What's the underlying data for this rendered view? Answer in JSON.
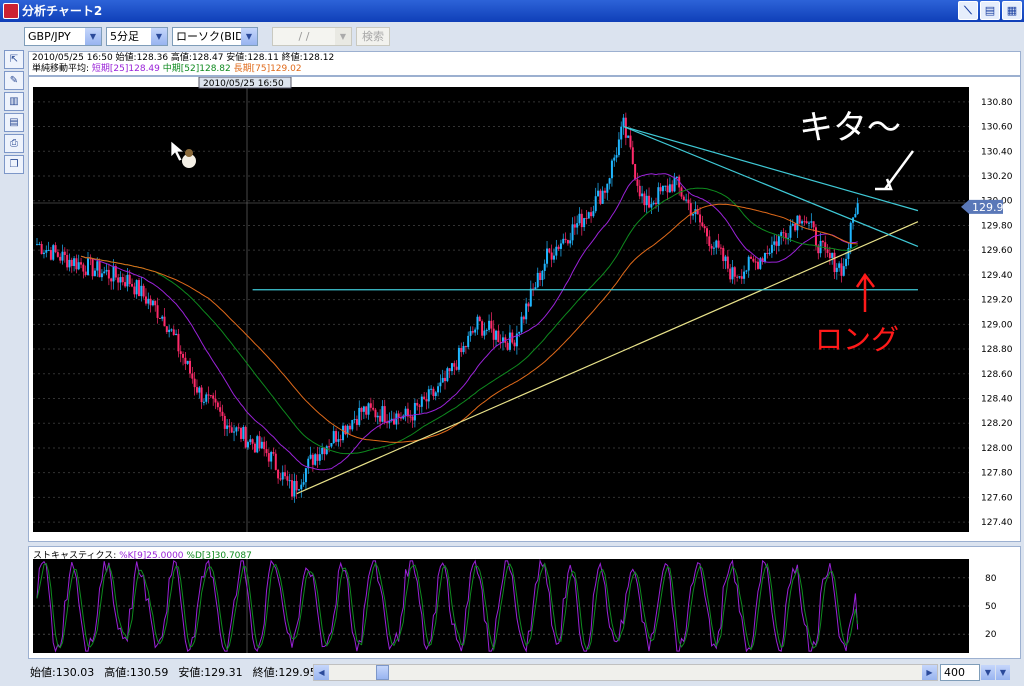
{
  "window": {
    "title": "分析チャート2"
  },
  "toolbar": {
    "pair": "GBP/JPY",
    "timeframe": "5分足",
    "chart_type": "ローソク(BID)",
    "date_placeholder": " / / ",
    "search_label": "検索"
  },
  "info": {
    "line1": "2010/05/25 16:50 始値:128.36 高値:128.47 安値:128.11 終値:128.12",
    "ma_title": "単純移動平均:",
    "ma_short": "短期[25]128.49",
    "ma_mid": "中期[52]128.82",
    "ma_long": "長期[75]129.02"
  },
  "cursor_time": "2010/05/25 16:50",
  "price_tag": "129.95",
  "annotations": {
    "top": "キタ〜",
    "bottom": "ロング"
  },
  "stoch": {
    "label": "ストキャスティクス:",
    "k": "%K[9]25.0000",
    "d": "%D[3]30.7087"
  },
  "bottom": {
    "open": "始値:130.03",
    "high": "高値:130.59",
    "low": "安値:129.31",
    "close": "終値:129.95",
    "count": "400"
  },
  "colors": {
    "up": "#1fb6ff",
    "down": "#ff2a6a",
    "ma_short": "#9a22d8",
    "ma_mid": "#0e8a1e",
    "ma_long": "#e06a1a",
    "trend_support": "#e8e28a",
    "trend_resist": "#3fc9d6",
    "annotation_white": "#ffffff",
    "annotation_red": "#ff1a1a"
  },
  "chart_data": [
    {
      "type": "candlestick",
      "title": "GBP/JPY 5分足",
      "yticks": [
        "130.80",
        "130.60",
        "130.40",
        "130.20",
        "130.00",
        "129.80",
        "129.60",
        "129.40",
        "129.20",
        "129.00",
        "128.80",
        "128.60",
        "128.40",
        "128.20",
        "128.00",
        "127.80",
        "127.60",
        "127.40"
      ],
      "ylim": [
        127.32,
        130.92
      ],
      "key_points": [
        {
          "i": 0,
          "p": 129.65
        },
        {
          "i": 10,
          "p": 129.55
        },
        {
          "i": 24,
          "p": 129.45
        },
        {
          "i": 40,
          "p": 129.35
        },
        {
          "i": 55,
          "p": 129.05
        },
        {
          "i": 70,
          "p": 128.45
        },
        {
          "i": 85,
          "p": 128.15
        },
        {
          "i": 100,
          "p": 127.95
        },
        {
          "i": 110,
          "p": 127.65
        },
        {
          "i": 120,
          "p": 127.95
        },
        {
          "i": 140,
          "p": 128.3
        },
        {
          "i": 160,
          "p": 128.25
        },
        {
          "i": 175,
          "p": 128.5
        },
        {
          "i": 190,
          "p": 129.0
        },
        {
          "i": 205,
          "p": 128.85
        },
        {
          "i": 220,
          "p": 129.55
        },
        {
          "i": 235,
          "p": 129.85
        },
        {
          "i": 245,
          "p": 130.1
        },
        {
          "i": 253,
          "p": 130.6
        },
        {
          "i": 262,
          "p": 129.95
        },
        {
          "i": 275,
          "p": 130.15
        },
        {
          "i": 285,
          "p": 129.85
        },
        {
          "i": 300,
          "p": 129.4
        },
        {
          "i": 310,
          "p": 129.5
        },
        {
          "i": 320,
          "p": 129.7
        },
        {
          "i": 330,
          "p": 129.9
        },
        {
          "i": 340,
          "p": 129.55
        },
        {
          "i": 348,
          "p": 129.45
        },
        {
          "i": 353,
          "p": 129.95
        }
      ],
      "moving_averages": [
        {
          "name": "短期[25]",
          "period": 25
        },
        {
          "name": "中期[52]",
          "period": 52
        },
        {
          "name": "長期[75]",
          "period": 75
        }
      ],
      "trendlines": [
        {
          "name": "support",
          "from": {
            "i": 112,
            "p": 127.63
          },
          "to": {
            "i": 380,
            "p": 129.83
          }
        },
        {
          "name": "resistance-1",
          "from": {
            "i": 253,
            "p": 130.6
          },
          "to": {
            "i": 380,
            "p": 129.92
          }
        },
        {
          "name": "resistance-2",
          "from": {
            "i": 253,
            "p": 130.6
          },
          "to": {
            "i": 380,
            "p": 129.63
          }
        },
        {
          "name": "horizontal",
          "from": {
            "i": 93,
            "p": 129.28
          },
          "to": {
            "i": 380,
            "p": 129.28
          }
        }
      ]
    },
    {
      "type": "line",
      "title": "ストキャスティクス",
      "yticks": [
        "80",
        "50",
        "20"
      ],
      "ylim": [
        0,
        100
      ],
      "series": [
        {
          "name": "%K[9]",
          "last": 25.0
        },
        {
          "name": "%D[3]",
          "last": 30.7087
        }
      ]
    }
  ]
}
